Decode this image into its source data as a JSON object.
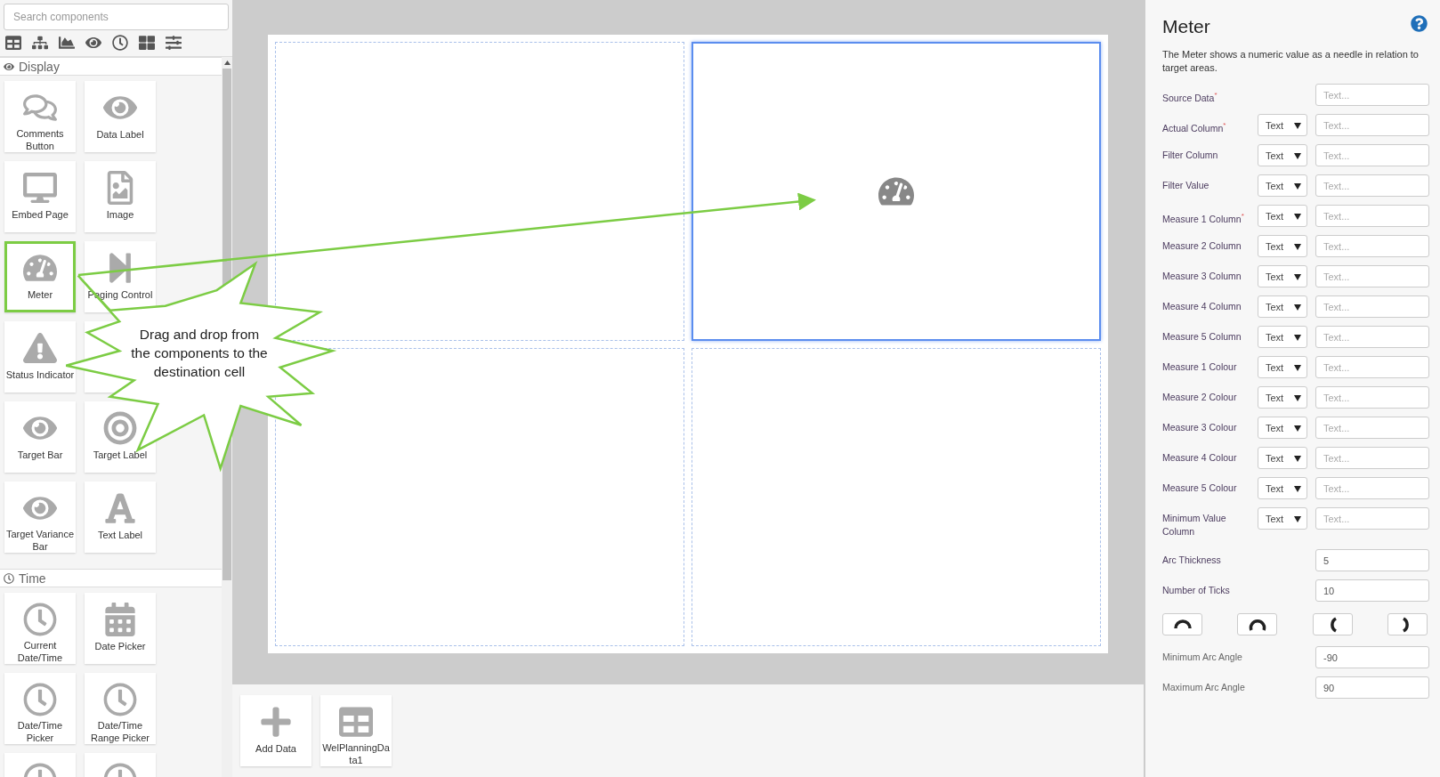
{
  "sidebar": {
    "search": {
      "placeholder": "Search components"
    },
    "sections": [
      {
        "title": "Display",
        "kind": "eye",
        "tiles": [
          {
            "label": "Comments Button",
            "kind": "comments",
            "selected": false
          },
          {
            "label": "Data Label",
            "kind": "eye",
            "selected": false
          },
          {
            "label": "Embed Page",
            "kind": "monitor",
            "selected": false
          },
          {
            "label": "Image",
            "kind": "image",
            "selected": false
          },
          {
            "label": "Meter",
            "kind": "meter",
            "selected": true
          },
          {
            "label": "Paging Control",
            "kind": "paging",
            "selected": false
          },
          {
            "label": "Status Indicator",
            "kind": "warning",
            "selected": false
          },
          {
            "kind": "covered",
            "selected": false
          },
          {
            "label": "Target Bar",
            "kind": "eye",
            "selected": false
          },
          {
            "label": "Target Label",
            "kind": "target",
            "selected": false
          },
          {
            "label": "Target Variance Bar",
            "kind": "eye",
            "selected": false
          },
          {
            "label": "Text Label",
            "kind": "font",
            "selected": false
          }
        ]
      },
      {
        "title": "Time",
        "kind": "clock",
        "tiles": [
          {
            "label": "Current Date/Time",
            "kind": "clock",
            "selected": false
          },
          {
            "label": "Date Picker",
            "kind": "calendar",
            "selected": false
          },
          {
            "label": "Date/Time Picker",
            "kind": "clock",
            "selected": false
          },
          {
            "label": "Date/Time Range Picker",
            "kind": "clock",
            "selected": false
          },
          {
            "kind": "clock",
            "selected": false
          },
          {
            "kind": "clock",
            "selected": false
          }
        ]
      }
    ]
  },
  "canvas": {
    "cells": [
      {
        "selected": false,
        "kind": "empty"
      },
      {
        "selected": true,
        "kind": "meter"
      },
      {
        "selected": false,
        "kind": "empty"
      },
      {
        "selected": false,
        "kind": "empty"
      }
    ]
  },
  "callout": {
    "text": "Drag and drop from the components to the destination cell"
  },
  "data_sources": [
    {
      "label": "Add Data",
      "kind": "add"
    },
    {
      "label": "WelPlanningData1",
      "kind": "table"
    }
  ],
  "properties": {
    "title": "Meter",
    "description": "The Meter shows a numeric value as a needle in relation to target areas.",
    "fields": [
      {
        "label": "Source Data$^{*}$",
        "placeholder": "Text..."
      },
      {
        "label": "Actual Column$^{*}$",
        "type": "Text",
        "placeholder": "Text..."
      },
      {
        "label": "Filter Column",
        "type": "Text",
        "placeholder": "Text..."
      },
      {
        "label": "Filter Value",
        "type": "Text",
        "placeholder": "Text..."
      },
      {
        "label": "Measure 1 Column$^{*}$",
        "type": "Text",
        "placeholder": "Text..."
      },
      {
        "label": "Measure 2 Column",
        "type": "Text",
        "placeholder": "Text..."
      },
      {
        "label": "Measure 3 Column",
        "type": "Text",
        "placeholder": "Text..."
      },
      {
        "label": "Measure 4 Column",
        "type": "Text",
        "placeholder": "Text..."
      },
      {
        "label": "Measure 5 Column",
        "type": "Text",
        "placeholder": "Text..."
      },
      {
        "label": "Measure 1 Colour",
        "type": "Text",
        "placeholder": "Text..."
      },
      {
        "label": "Measure 2 Colour",
        "type": "Text",
        "placeholder": "Text..."
      },
      {
        "label": "Measure 3 Colour",
        "type": "Text",
        "placeholder": "Text..."
      },
      {
        "label": "Measure 4 Colour",
        "type": "Text",
        "placeholder": "Text..."
      },
      {
        "label": "Measure 5 Colour",
        "type": "Text",
        "placeholder": "Text..."
      },
      {
        "label": "Minimum Value Column",
        "type": "Text",
        "placeholder": "Text..."
      },
      {
        "label": "Arc Thickness",
        "value": "5"
      },
      {
        "label": "Number of Ticks",
        "value": "10"
      }
    ],
    "arc_buttons": [
      {
        "kind": "top"
      },
      {
        "kind": "full"
      },
      {
        "kind": "left"
      },
      {
        "kind": "right"
      }
    ],
    "angle_fields": [
      {
        "label": "Minimum Arc Angle",
        "value": "-90"
      },
      {
        "label": "Maximum Arc Angle",
        "value": "90"
      }
    ]
  }
}
